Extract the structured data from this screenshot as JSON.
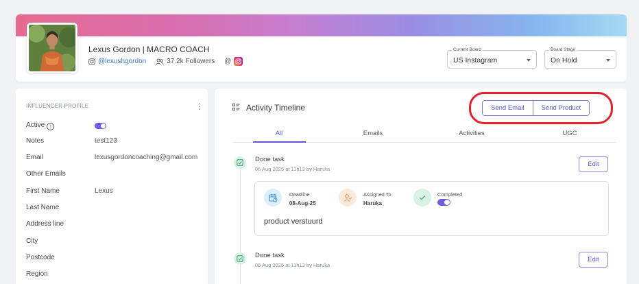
{
  "header": {
    "name": "Lexus Gordon | MACRO COACH",
    "handle": "@lexushgordon",
    "followers": "37.2k Followers",
    "at_symbol": "@",
    "current_board": {
      "label": "Current Board",
      "value": "US Instagram"
    },
    "board_stage": {
      "label": "Board Stage",
      "value": "On Hold"
    }
  },
  "profile": {
    "section_title": "INFLUENCER PROFILE",
    "kebab": "⋮",
    "active_label": "Active",
    "active_on": true,
    "rows": [
      {
        "label": "Notes",
        "value": "test123"
      },
      {
        "label": "Email",
        "value": "lexusgordoncoaching@gmail.com"
      },
      {
        "label": "Other Emails",
        "value": ""
      },
      {
        "label": "First Name",
        "value": "Lexus"
      },
      {
        "label": "Last Name",
        "value": ""
      },
      {
        "label": "Address line",
        "value": ""
      },
      {
        "label": "City",
        "value": ""
      },
      {
        "label": "Postcode",
        "value": ""
      },
      {
        "label": "Region",
        "value": ""
      }
    ]
  },
  "activity": {
    "title": "Activity Timeline",
    "send_email": "Send Email",
    "send_product": "Send Product",
    "tabs": [
      "All",
      "Emails",
      "Activities",
      "UGC"
    ],
    "active_tab": "All",
    "events": [
      {
        "title": "Done task",
        "date": "06 Aug 2025 at 11h13 by Haruka",
        "edit": "Edit",
        "deadline_label": "Deadline",
        "deadline_value": "08-Aug-25",
        "assigned_label": "Assigned To",
        "assigned_value": "Haruka",
        "completed_label": "Completed",
        "completed_on": true,
        "note": "product verstuurd"
      },
      {
        "title": "Done task",
        "date": "06 Aug 2025 at 11h13 by Haruka",
        "edit": "Edit"
      }
    ]
  },
  "colors": {
    "accent": "#5a55d6",
    "toggle": "#6d5fe0",
    "highlight_ring": "#e4202a",
    "handle_link": "#3b7fc4"
  }
}
